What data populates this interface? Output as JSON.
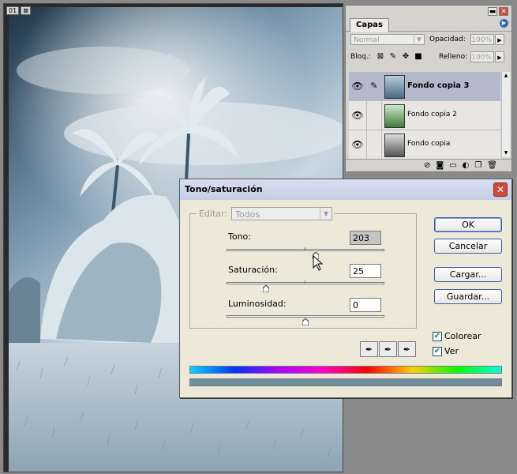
{
  "document_window": {
    "tabs": [
      "01",
      "⊠"
    ]
  },
  "layers_panel": {
    "tab_label": "Capas",
    "blend_mode": "Normal",
    "opacity_label": "Opacidad:",
    "opacity_value": "100%",
    "lock_label": "Bloq.:",
    "fill_label": "Relleno:",
    "fill_value": "100%",
    "layers": [
      {
        "name": "Fondo copia 3",
        "selected": true,
        "thumb_color": "#4a6a84"
      },
      {
        "name": "Fondo copia 2",
        "selected": false,
        "thumb_color": "#5f9a5a"
      },
      {
        "name": "Fondo copia",
        "selected": false,
        "thumb_color": "#8a8a8a"
      }
    ]
  },
  "dialog": {
    "title": "Tono/saturación",
    "edit_label": "Editar:",
    "edit_value": "Todos",
    "hue": {
      "label": "Tono:",
      "value": "203",
      "fraction": 0.565
    },
    "saturation": {
      "label": "Saturación:",
      "value": "25",
      "fraction": 0.25
    },
    "lightness": {
      "label": "Luminosidad:",
      "value": "0",
      "fraction": 0.5
    },
    "buttons": {
      "ok": "OK",
      "cancel": "Cancelar",
      "load": "Cargar...",
      "save": "Guardar..."
    },
    "colorize_label": "Colorear",
    "colorize_checked": true,
    "preview_label": "Ver",
    "preview_checked": true,
    "result_color": "#6e8fa0"
  }
}
